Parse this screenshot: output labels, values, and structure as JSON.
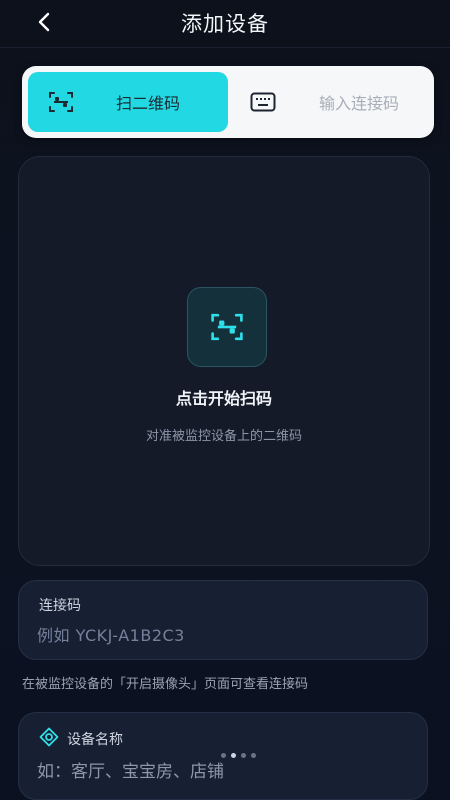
{
  "header": {
    "title": "添加设备",
    "back_icon": "chevron-left-icon"
  },
  "tabs": [
    {
      "label": "扫二维码",
      "icon": "qr-scan-icon",
      "active": true
    },
    {
      "label": "输入连接码",
      "icon": "keyboard-icon",
      "active": false
    }
  ],
  "scan": {
    "icon": "qr-scan-icon",
    "title": "点击开始扫码",
    "subtitle": "对准被监控设备上的二维码"
  },
  "connection_code": {
    "label": "连接码",
    "value": "",
    "placeholder": "例如 YCKJ-A1B2C3"
  },
  "hint": "在被监控设备的「开启摄像头」页面可查看连接码",
  "device_name": {
    "icon": "device-tag-icon",
    "label": "设备名称",
    "value": "",
    "placeholder": "如：客厅、宝宝房、店铺"
  },
  "page_indicator": {
    "count": 4,
    "active_index": 1
  },
  "colors": {
    "accent": "#22d9e3",
    "background": "#0c1220",
    "card": "#172033"
  }
}
